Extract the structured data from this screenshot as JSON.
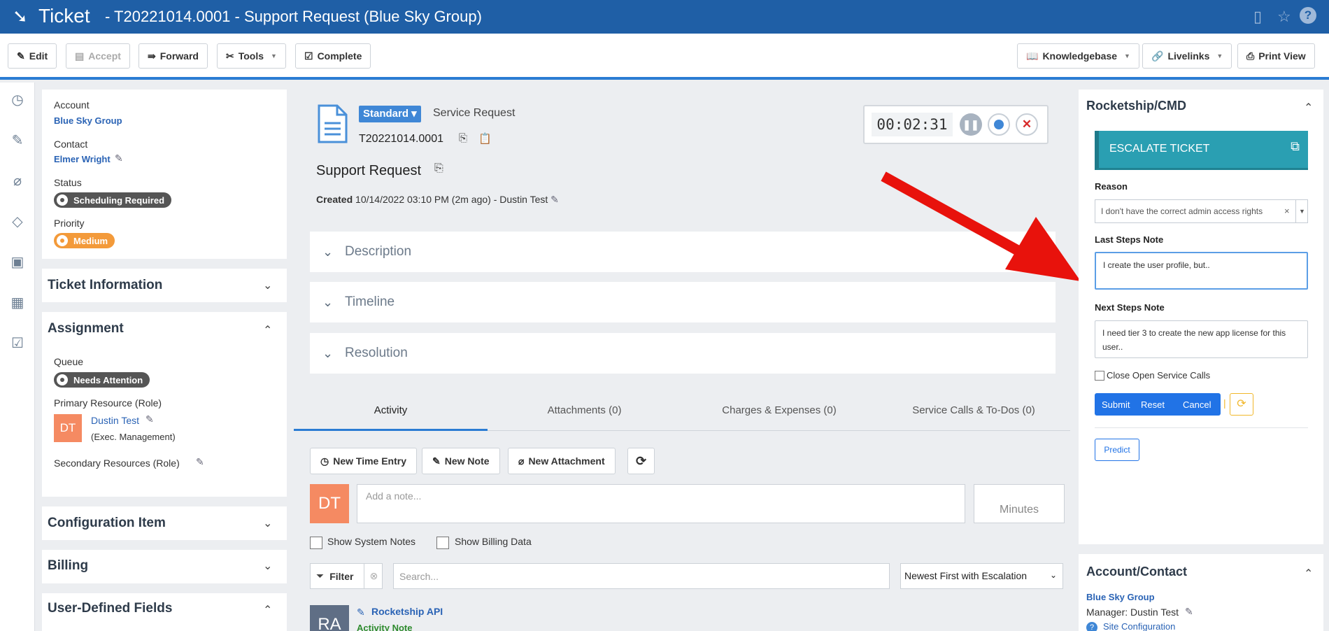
{
  "header": {
    "title_main": "Ticket",
    "title_rest": "- T20221014.0001 - Support Request (Blue Sky Group)",
    "icons": [
      "panel-icon",
      "star-icon",
      "help-icon"
    ]
  },
  "toolbar": {
    "edit": "Edit",
    "accept": "Accept",
    "forward": "Forward",
    "tools": "Tools",
    "complete": "Complete",
    "knowledgebase": "Knowledgebase",
    "livelinks": "Livelinks",
    "print_view": "Print View"
  },
  "left": {
    "account_label": "Account",
    "account_value": "Blue Sky Group",
    "contact_label": "Contact",
    "contact_value": "Elmer Wright",
    "status_label": "Status",
    "status_value": "Scheduling Required",
    "priority_label": "Priority",
    "priority_value": "Medium",
    "sections": {
      "ticket_info": "Ticket Information",
      "assignment": "Assignment",
      "config_item": "Configuration Item",
      "billing": "Billing",
      "udf": "User-Defined Fields"
    },
    "queue_label": "Queue",
    "queue_value": "Needs Attention",
    "primary_label": "Primary Resource (Role)",
    "primary_initials": "DT",
    "primary_name": "Dustin Test",
    "primary_role": "(Exec. Management)",
    "secondary_label": "Secondary Resources (Role)"
  },
  "ticket": {
    "type_badge": "Standard",
    "type_text": "Service Request",
    "number": "T20221014.0001",
    "title": "Support Request",
    "created_label": "Created",
    "created_value": "10/14/2022 03:10 PM (2m ago)",
    "created_sep": "-",
    "created_by": "Dustin Test",
    "timer": "00:02:31",
    "panels": [
      "Description",
      "Timeline",
      "Resolution"
    ]
  },
  "tabs": [
    "Activity",
    "Attachments (0)",
    "Charges & Expenses (0)",
    "Service Calls & To-Dos (0)"
  ],
  "activity": {
    "new_time_entry": "New Time Entry",
    "new_note": "New Note",
    "new_attachment": "New Attachment",
    "avatar": "DT",
    "note_placeholder": "Add a note...",
    "minutes_placeholder": "Minutes",
    "show_system_notes": "Show System Notes",
    "show_billing_data": "Show Billing Data",
    "filter": "Filter",
    "search_placeholder": "Search...",
    "sort": "Newest First with Escalation",
    "entry_avatar": "RA",
    "entry_author": "Rocketship API",
    "entry_type": "Activity Note"
  },
  "rocketship": {
    "title": "Rocketship/CMD",
    "escalate": "ESCALATE TICKET",
    "reason_label": "Reason",
    "reason_value": "I don't have the correct admin access rights",
    "last_steps_label": "Last Steps Note",
    "last_steps_value": "I create the user profile, but..",
    "next_steps_label": "Next Steps Note",
    "next_steps_value": "I need tier 3 to create the new app license for this user..",
    "close_calls": "Close Open Service Calls",
    "submit": "Submit",
    "reset": "Reset",
    "cancel": "Cancel",
    "predict": "Predict"
  },
  "account_contact": {
    "title": "Account/Contact",
    "account": "Blue Sky Group",
    "manager": "Manager: Dustin Test",
    "site_config": "Site Configuration"
  },
  "colors": {
    "header_blue": "#1f5fa6",
    "link_blue": "#2a63b5",
    "escalate_teal": "#2a9fb2",
    "primary_button": "#2173e6",
    "priority_orange": "#f39a3a",
    "avatar_orange": "#f58a62",
    "annotation_red": "#e8120c"
  }
}
